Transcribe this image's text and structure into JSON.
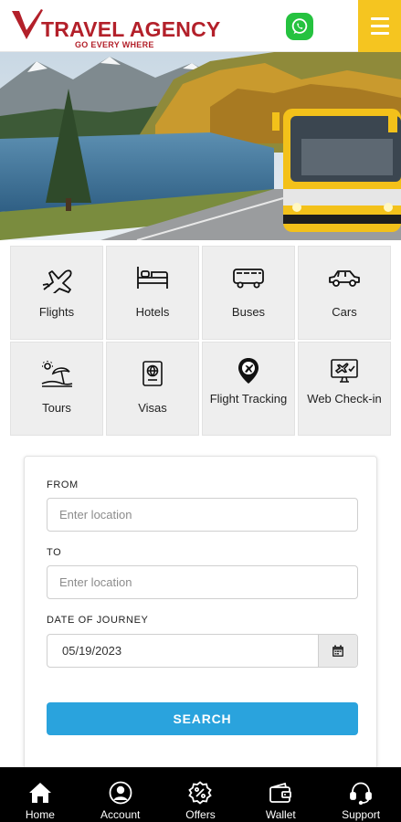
{
  "header": {
    "brand": "TRAVEL AGENCY",
    "tagline": "GO EVERY WHERE",
    "brand_color": "#b3202a",
    "whatsapp_icon": "whatsapp-icon",
    "menu_icon": "hamburger-menu-icon",
    "menu_color": "#f5c520"
  },
  "services": [
    {
      "label": "Flights",
      "icon": "airplane-icon"
    },
    {
      "label": "Hotels",
      "icon": "bed-icon"
    },
    {
      "label": "Buses",
      "icon": "bus-icon"
    },
    {
      "label": "Cars",
      "icon": "car-icon"
    },
    {
      "label": "Tours",
      "icon": "beach-umbrella-icon"
    },
    {
      "label": "Visas",
      "icon": "passport-icon"
    },
    {
      "label": "Flight Tracking",
      "icon": "flight-location-icon"
    },
    {
      "label": "Web Check-in",
      "icon": "web-checkin-icon"
    }
  ],
  "search_form": {
    "from_label": "FROM",
    "from_placeholder": "Enter location",
    "from_value": "",
    "to_label": "TO",
    "to_placeholder": "Enter location",
    "to_value": "",
    "date_label": "DATE OF JOURNEY",
    "date_value": "05/19/2023",
    "calendar_icon": "calendar-icon",
    "search_label": "SEARCH",
    "search_color": "#2aa3dd"
  },
  "bottom_nav": [
    {
      "label": "Home",
      "icon": "home-icon"
    },
    {
      "label": "Account",
      "icon": "account-icon"
    },
    {
      "label": "Offers",
      "icon": "offers-icon"
    },
    {
      "label": "Wallet",
      "icon": "wallet-icon"
    },
    {
      "label": "Support",
      "icon": "support-icon"
    }
  ]
}
